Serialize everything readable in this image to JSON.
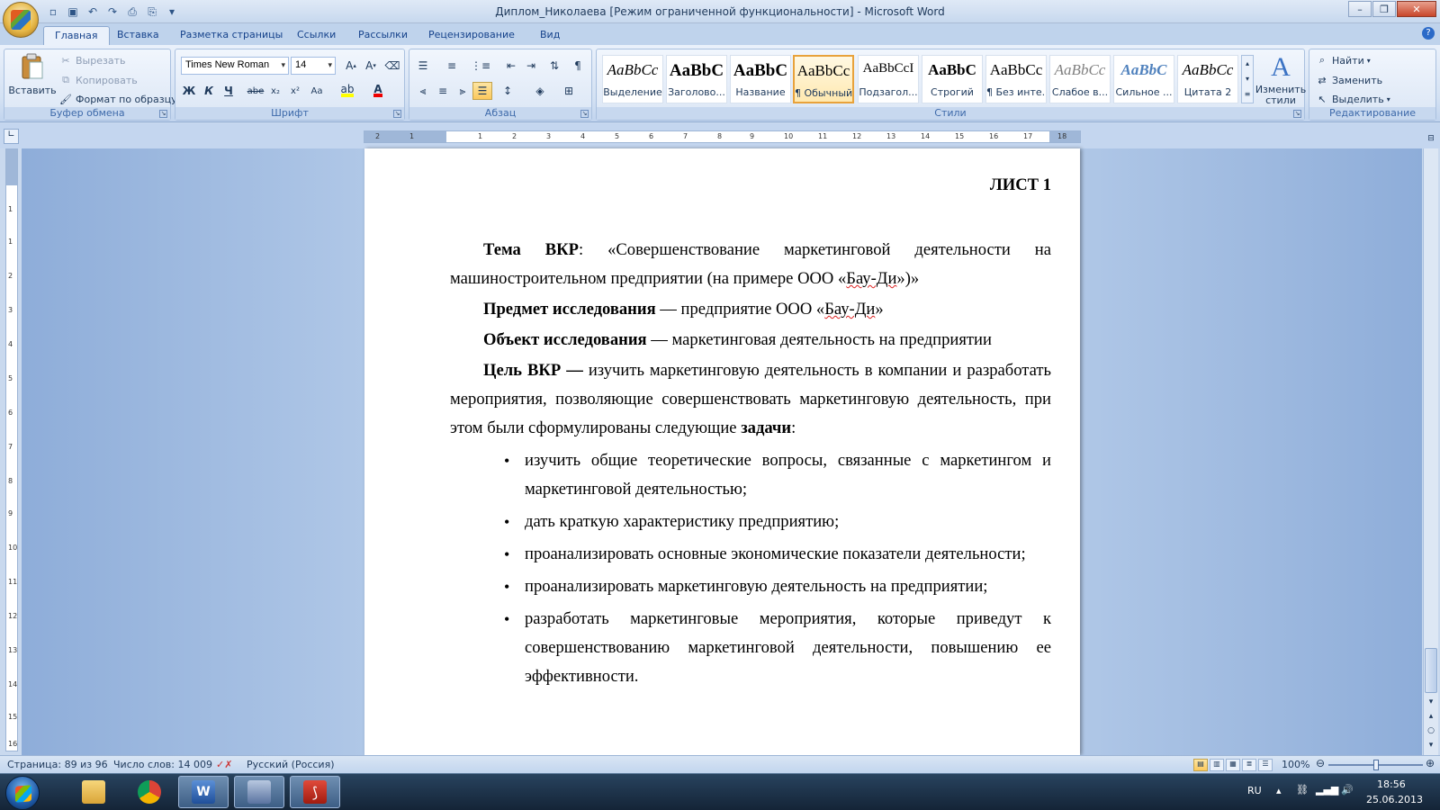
{
  "window": {
    "title": "Диплом_Николаева [Режим ограниченной функциональности] - Microsoft Word"
  },
  "tabs": [
    "Главная",
    "Вставка",
    "Разметка страницы",
    "Ссылки",
    "Рассылки",
    "Рецензирование",
    "Вид"
  ],
  "clipboard": {
    "paste": "Вставить",
    "cut": "Вырезать",
    "copy": "Копировать",
    "format_painter": "Формат по образцу",
    "label": "Буфер обмена"
  },
  "font": {
    "family": "Times New Roman",
    "size": "14",
    "label": "Шрифт",
    "bold": "Ж",
    "italic": "К",
    "underline": "Ч",
    "strike": "abe",
    "sub": "x₂",
    "sup": "x²",
    "case": "Aa"
  },
  "paragraph": {
    "label": "Абзац"
  },
  "styles": {
    "label": "Стили",
    "items": [
      {
        "sample": "AaBbCc",
        "name": "Выделение"
      },
      {
        "sample": "AaBbC",
        "name": "Заголово..."
      },
      {
        "sample": "AaBbC",
        "name": "Название"
      },
      {
        "sample": "AaBbCc",
        "name": "¶ Обычный"
      },
      {
        "sample": "AaBbCcI",
        "name": "Подзагол..."
      },
      {
        "sample": "AaBbC",
        "name": "Строгий"
      },
      {
        "sample": "AaBbCc",
        "name": "¶ Без инте..."
      },
      {
        "sample": "AaBbCc",
        "name": "Слабое в..."
      },
      {
        "sample": "AaBbC",
        "name": "Сильное ..."
      },
      {
        "sample": "AaBbCc",
        "name": "Цитата 2"
      }
    ],
    "change": "Изменить стили"
  },
  "editing": {
    "label": "Редактирование",
    "find": "Найти",
    "replace": "Заменить",
    "select": "Выделить"
  },
  "ruler": {
    "h_ticks": [
      "2",
      "1",
      "1",
      "2",
      "3",
      "4",
      "5",
      "6",
      "7",
      "8",
      "9",
      "10",
      "11",
      "12",
      "13",
      "14",
      "15",
      "16",
      "17",
      "18"
    ],
    "v_ticks": [
      "1",
      "1",
      "2",
      "3",
      "4",
      "5",
      "6",
      "7",
      "8",
      "9",
      "10",
      "11",
      "12",
      "13",
      "14",
      "15",
      "16"
    ]
  },
  "document": {
    "sheet_title": "ЛИСТ 1",
    "p1": {
      "b1": "Тема ВКР",
      "t1": ": «Совершенствование маркетинговой деятельности на машиностроительном предприятии (на примере ООО «",
      "spell": "Бау-Ди",
      "t2": "»)»"
    },
    "p2": {
      "b1": "Предмет исследования",
      "t1": " — предприятие ООО «",
      "spell": "Бау-Ди",
      "t2": "»"
    },
    "p3": {
      "b1": "Объект исследования",
      "t1": " — маркетинговая деятельность на предприятии"
    },
    "p4": {
      "b1": "Цель ВКР —",
      "t1": " изучить маркетинговую деятельность в компании и разработать мероприятия, позволяющие совершенствовать маркетинговую деятельность, при этом были сформулированы следующие ",
      "b2": "задачи",
      "t2": ":"
    },
    "tasks": [
      "изучить общие теоретические вопросы, связанные с маркетингом и маркетинговой деятельностью;",
      "дать краткую характеристику предприятию;",
      "проанализировать основные экономические показатели деятельности;",
      "проанализировать маркетинговую деятельность на предприятии;",
      "разработать маркетинговые мероприятия, которые приведут к совершенствованию маркетинговой деятельности, повышению ее эффективности."
    ]
  },
  "status": {
    "page": "Страница: 89 из 96",
    "words": "Число слов: 14 009",
    "language": "Русский (Россия)",
    "zoom": "100%",
    "zoom_level": 0.5
  },
  "taskbar": {
    "lang": "RU",
    "time": "18:56",
    "date": "25.06.2013"
  }
}
